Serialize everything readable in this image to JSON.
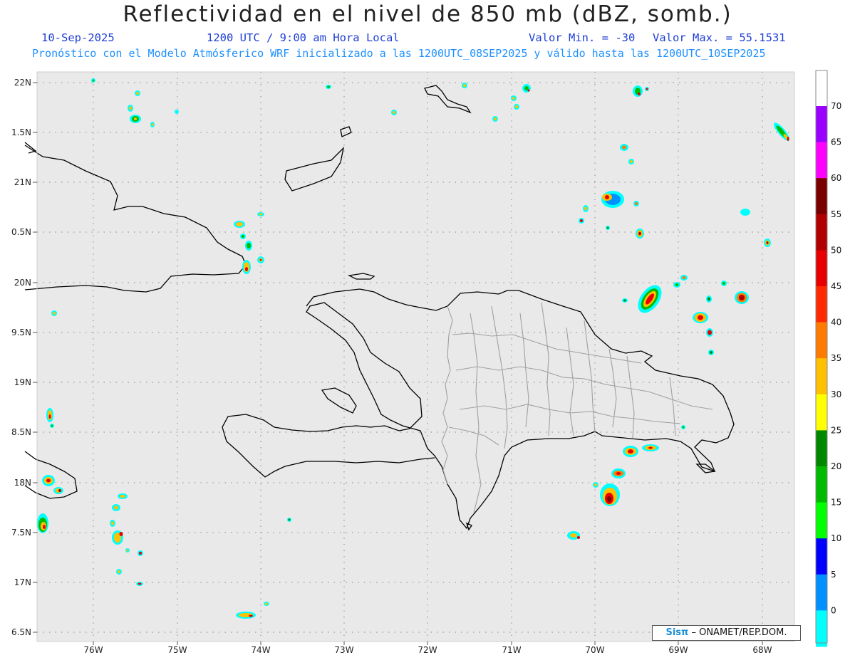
{
  "title": "Reflectividad en el nivel de 850 mb (dBZ, somb.)",
  "date": "10-Sep-2025",
  "time": "1200 UTC / 9:00 am Hora Local",
  "valmin": "Valor Min. = -30",
  "valmax": "Valor Max. = 55.1531",
  "forecast_line": "Pronóstico con el Modelo Atmósferico WRF inicializado a las 1200UTC_08SEP2025 y válido hasta las  1200UTC_10SEP2025",
  "footer_logo": "Sisπ",
  "footer_text": "– ONAMET/REP.DOM.",
  "lat_labels": [
    "22N",
    "1.5N",
    "21N",
    "0.5N",
    "20N",
    "9.5N",
    "19N",
    "8.5N",
    "18N",
    "7.5N",
    "17N",
    "6.5N"
  ],
  "lon_labels": [
    "76W",
    "75W",
    "74W",
    "73W",
    "72W",
    "71W",
    "70W",
    "69W",
    "68W"
  ],
  "colorbar": {
    "labels": [
      "70",
      "65",
      "60",
      "55",
      "50",
      "45",
      "40",
      "35",
      "30",
      "25",
      "20",
      "15",
      "10",
      "5",
      "0"
    ],
    "colors": [
      "#9a00ff",
      "#ff00ff",
      "#7a0000",
      "#b20000",
      "#e80000",
      "#ff2a00",
      "#ff7a00",
      "#ffc000",
      "#ffff00",
      "#008800",
      "#00bb00",
      "#00ff00",
      "#0000ff",
      "#0090ff",
      "#00ffff",
      "#e6e6e6"
    ]
  },
  "colors": {
    "map_background": "#e9e9e9",
    "coast": "#000000",
    "province_border": "#a0a0a0",
    "title_blue": "#1f3fd6",
    "subtitle_cyan": "#1e90ff"
  }
}
